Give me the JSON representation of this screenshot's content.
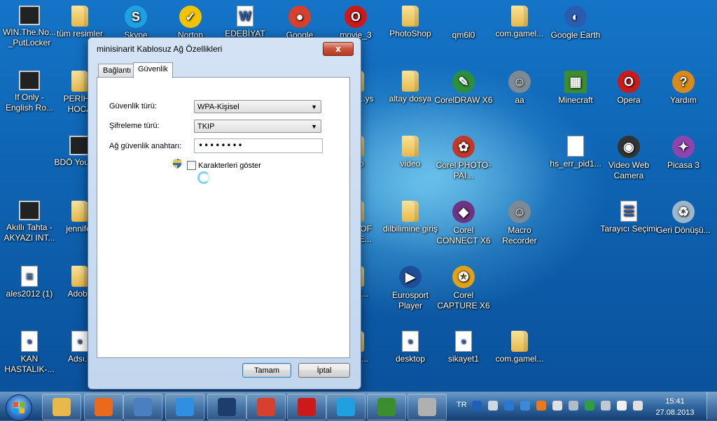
{
  "desktop": {
    "icons": [
      {
        "label": "WIN.The.No... _PutLocker",
        "icon": "video-file-icon"
      },
      {
        "label": "tüm resimler",
        "icon": "folder-icon"
      },
      {
        "label": "Skype",
        "icon": "skype-icon"
      },
      {
        "label": "Norton",
        "icon": "norton-icon"
      },
      {
        "label": "EDEBİYAT",
        "icon": "word-document-icon"
      },
      {
        "label": "Google",
        "icon": "chrome-icon"
      },
      {
        "label": "movie_3",
        "icon": "opera-icon"
      },
      {
        "label": "PhotoShop",
        "icon": "folder-icon"
      },
      {
        "label": "qm6l0",
        "icon": "blank-icon"
      },
      {
        "label": "com.gamel...",
        "icon": "folder-icon"
      },
      {
        "label": "Google Earth",
        "icon": "google-earth-icon"
      },
      {
        "label": "If Only - English Ro...",
        "icon": "video-file-icon"
      },
      {
        "label": "PERİH... HOCA",
        "icon": "folder-icon"
      },
      {
        "label": "hoca ...ys",
        "icon": "folder-icon"
      },
      {
        "label": "altay dosya",
        "icon": "folder-icon"
      },
      {
        "label": "CorelDRAW X6",
        "icon": "coreldraw-icon"
      },
      {
        "label": "aa",
        "icon": "robot-icon"
      },
      {
        "label": "Minecraft",
        "icon": "minecraft-icon"
      },
      {
        "label": "Opera",
        "icon": "opera-icon"
      },
      {
        "label": "Yardım",
        "icon": "help-icon"
      },
      {
        "label": "BDÖ YouTu...",
        "icon": "film-icon"
      },
      {
        "label": "...op",
        "icon": "folder-icon"
      },
      {
        "label": "video",
        "icon": "folder-icon"
      },
      {
        "label": "Corel PHOTO-PAI...",
        "icon": "corel-photopaint-icon"
      },
      {
        "label": "hs_err_pid1...",
        "icon": "text-document-icon"
      },
      {
        "label": "Video Web Camera",
        "icon": "webcam-icon"
      },
      {
        "label": "Picasa 3",
        "icon": "picasa-icon"
      },
      {
        "label": "Akıllı Tahta - AKYAZI INT...",
        "icon": "video-file-icon"
      },
      {
        "label": "jennifer",
        "icon": "folder-icon"
      },
      {
        "label": "...RY OF ...AGE...",
        "icon": "folder-icon"
      },
      {
        "label": "dilbilimine giriş",
        "icon": "folder-icon"
      },
      {
        "label": "Corel CONNECT X6",
        "icon": "corel-connect-icon"
      },
      {
        "label": "Macro Recorder",
        "icon": "robot-icon"
      },
      {
        "label": "Tarayıcı Seçimi",
        "icon": "browser-choice-icon"
      },
      {
        "label": "Geri Dönüşü...",
        "icon": "recycle-bin-icon"
      },
      {
        "label": "ales2012 (1)",
        "icon": "document-icon"
      },
      {
        "label": "Adobe",
        "icon": "folder-icon"
      },
      {
        "label": "...rigi...",
        "icon": "folder-icon"
      },
      {
        "label": "Eurosport Player",
        "icon": "eurosport-icon"
      },
      {
        "label": "Corel CAPTURE X6",
        "icon": "corel-capture-icon"
      },
      {
        "label": "KAN HASTALIK-...",
        "icon": "image-file-icon"
      },
      {
        "label": "Adsı...",
        "icon": "image-file-icon"
      },
      {
        "label": "...nlo...",
        "icon": "folder-icon"
      },
      {
        "label": "desktop",
        "icon": "image-file-icon"
      },
      {
        "label": "sikayet1",
        "icon": "image-file-icon"
      },
      {
        "label": "com.gamel...",
        "icon": "folder-icon"
      }
    ]
  },
  "dialog": {
    "title": "minisinarit Kablosuz Ağ Özellikleri",
    "close_label": "x",
    "tabs": [
      {
        "label": "Bağlantı",
        "active": false
      },
      {
        "label": "Güvenlik",
        "active": true
      }
    ],
    "security_type_label": "Güvenlik türü:",
    "security_type_value": "WPA-Kişisel",
    "encryption_type_label": "Şifreleme türü:",
    "encryption_type_value": "TKIP",
    "key_label": "Ağ güvenlik anahtarı:",
    "key_value": "••••••••",
    "show_chars_label": "Karakterleri göster",
    "show_chars_checked": false,
    "ok_label": "Tamam",
    "cancel_label": "İptal"
  },
  "taskbar": {
    "apps": [
      {
        "name": "explorer-icon",
        "color": "#e8b94a"
      },
      {
        "name": "media-player-icon",
        "color": "#e86a1a"
      },
      {
        "name": "tool-icon",
        "color": "#4a7fc0"
      },
      {
        "name": "internet-explorer-icon",
        "color": "#2f8fe0"
      },
      {
        "name": "photoshop-icon",
        "color": "#1c3d6e"
      },
      {
        "name": "chrome-icon",
        "color": "#d6402c"
      },
      {
        "name": "opera-icon",
        "color": "#cc1a1a"
      },
      {
        "name": "skype-icon",
        "color": "#1fa0e0"
      },
      {
        "name": "minecraft-icon",
        "color": "#3c8d2e"
      },
      {
        "name": "camera-icon",
        "color": "#b0b0b0"
      }
    ],
    "language": "TR",
    "clock_time": "15:41",
    "clock_date": "27.08.2013"
  }
}
